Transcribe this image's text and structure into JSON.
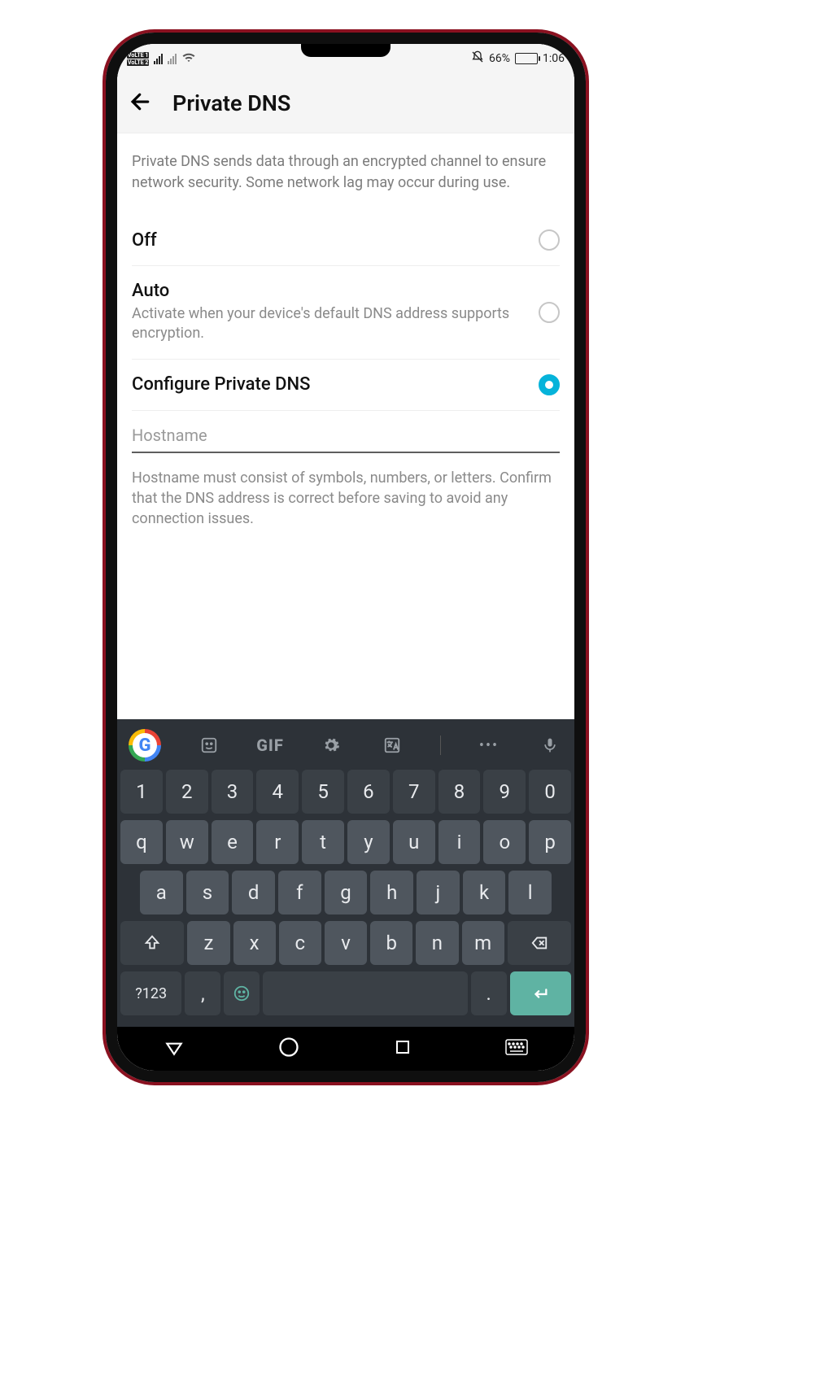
{
  "statusbar": {
    "volte1": "VoLTE 1",
    "volte2": "VoLTE 2",
    "battery_pct": "66%",
    "time": "1:06"
  },
  "header": {
    "title": "Private DNS"
  },
  "description": "Private DNS sends data through an encrypted channel to ensure network security. Some network lag may occur during use.",
  "options": {
    "off": {
      "title": "Off"
    },
    "auto": {
      "title": "Auto",
      "subtitle": "Activate when your device's default DNS address supports encryption."
    },
    "configure": {
      "title": "Configure Private DNS"
    }
  },
  "hostname": {
    "value": "",
    "placeholder": "Hostname",
    "help": "Hostname must consist of symbols, numbers, or letters. Confirm that the DNS address is correct before saving to avoid any connection issues."
  },
  "keyboard": {
    "top": {
      "gif": "GIF"
    },
    "row1": [
      "1",
      "2",
      "3",
      "4",
      "5",
      "6",
      "7",
      "8",
      "9",
      "0"
    ],
    "row2": [
      "q",
      "w",
      "e",
      "r",
      "t",
      "y",
      "u",
      "i",
      "o",
      "p"
    ],
    "row3": [
      "a",
      "s",
      "d",
      "f",
      "g",
      "h",
      "j",
      "k",
      "l"
    ],
    "row4": [
      "z",
      "x",
      "c",
      "v",
      "b",
      "n",
      "m"
    ],
    "symbols": "?123",
    "comma": ",",
    "period": "."
  }
}
